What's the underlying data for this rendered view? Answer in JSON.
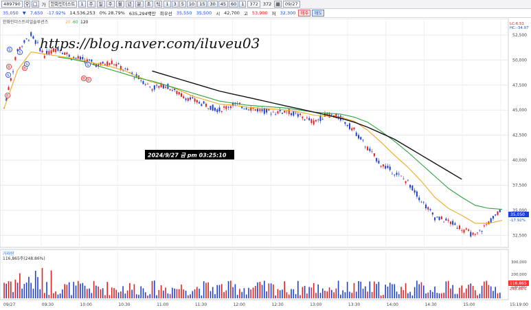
{
  "toolbar": {
    "code": "489790",
    "lock_icon": "lock-icon",
    "search_icon": "search-icon",
    "name_prefix": "가",
    "name": "한화인더스트",
    "b1": "1",
    "b2": "주",
    "b3": "일",
    "b4": "주",
    "b5": "월",
    "b6": "년",
    "b7": "분",
    "b8": "초",
    "b9": "틱",
    "nums": [
      "1",
      "3",
      "5",
      "10",
      "15",
      "30",
      "45",
      "60",
      "1"
    ],
    "count": "372",
    "count_total": "372",
    "date": "09/27"
  },
  "quote": {
    "price": "35,050",
    "change": "▼",
    "change_val": "7,650",
    "pct": "-17.92%",
    "volume": "14,536,253",
    "vol_ratio": "0% 28.79%",
    "amount": "635,294백만",
    "pref_label": "최우선",
    "ask": "35,550",
    "bid": "35,500",
    "open_label": "시",
    "open": "42,700",
    "high_label": "고",
    "high": "53,900",
    "low_label": "저",
    "low": "32,300",
    "buy": "매수",
    "sell": "매도"
  },
  "overlay_text": "https://blog.naver.com/iluveu03",
  "datetime_text": "2024/9/27 금 pm 03:25:10",
  "legend": {
    "name": "한화인더스트리얼솔루션즈",
    "ma": [
      "20",
      "60",
      "120"
    ]
  },
  "colors": {
    "ma20": "#f2a81d",
    "ma60": "#2aa33b",
    "ma120": "#111111",
    "up": "#e02020",
    "down": "#1c3fd6"
  },
  "price_axis": [
    "52,500",
    "50,000",
    "47,500",
    "45,000",
    "42,500",
    "40,000",
    "37,500",
    "35,000",
    "32,500"
  ],
  "price_tags": {
    "lc": "LC:6.51",
    "hc": "HC:-34.97",
    "cur": "35,050",
    "cur_pct": "-17.92%"
  },
  "volume_panel": {
    "title": "거래량",
    "value": "116,865주(248.86%)",
    "axis": [
      "300,000",
      "200,000",
      "100,000"
    ],
    "tag": "116,865",
    "tag2": "248.86%"
  },
  "time_axis": [
    "09/27",
    "09:30",
    "10:00",
    "10:30",
    "11:00",
    "11:30",
    "12:00",
    "12:30",
    "13:00",
    "13:30",
    "14:00",
    "14:30",
    "15:00",
    "15:19:00"
  ],
  "signal_labels": [
    "S",
    "B"
  ],
  "chart_data": {
    "type": "line",
    "series": [
      {
        "values": [
          45200,
          51000,
          52500,
          50500,
          51200,
          50300,
          50000,
          49500,
          49800,
          49000,
          48200,
          47200,
          47500,
          46600,
          46000,
          45500,
          45000,
          45600,
          45300,
          45000,
          44800,
          44900,
          44400,
          43800,
          44600,
          44200,
          43000,
          41200,
          39600,
          38800,
          37800,
          36000,
          34300,
          33900,
          33200,
          32400,
          33800,
          35050
        ]
      },
      {
        "values": [
          45200,
          49000,
          50800,
          50600,
          50400,
          50200,
          49900,
          49600,
          49300,
          48900,
          48300,
          47800,
          47500,
          47000,
          46400,
          46000,
          45600,
          45500,
          45300,
          45200,
          45100,
          45000,
          44800,
          44500,
          44400,
          44300,
          43900,
          43000,
          41800,
          40500,
          39300,
          37900,
          36300,
          35200,
          34500,
          33700,
          33700,
          34000
        ]
      },
      {
        "values": [
          null,
          null,
          null,
          null,
          50300,
          50100,
          49800,
          49400,
          49000,
          48600,
          48200,
          47900,
          47500,
          47100,
          46700,
          46300,
          45900,
          45700,
          45500,
          45400,
          45300,
          45200,
          45000,
          44800,
          44700,
          44600,
          44300,
          43800,
          42900,
          41900,
          40800,
          39600,
          38400,
          37200,
          36300,
          35500,
          35200,
          35100
        ]
      },
      {
        "values": [
          null,
          null,
          null,
          null,
          null,
          null,
          null,
          null,
          null,
          null,
          null,
          48900,
          48500,
          48100,
          47700,
          47300,
          46900,
          46600,
          46300,
          46000,
          45700,
          45400,
          45100,
          44800,
          44500,
          44200,
          43800,
          43300,
          42700,
          42100,
          41300,
          40500,
          39700,
          38900,
          38100,
          null,
          null,
          null
        ]
      }
    ],
    "ylim": [
      31500,
      54000
    ]
  }
}
